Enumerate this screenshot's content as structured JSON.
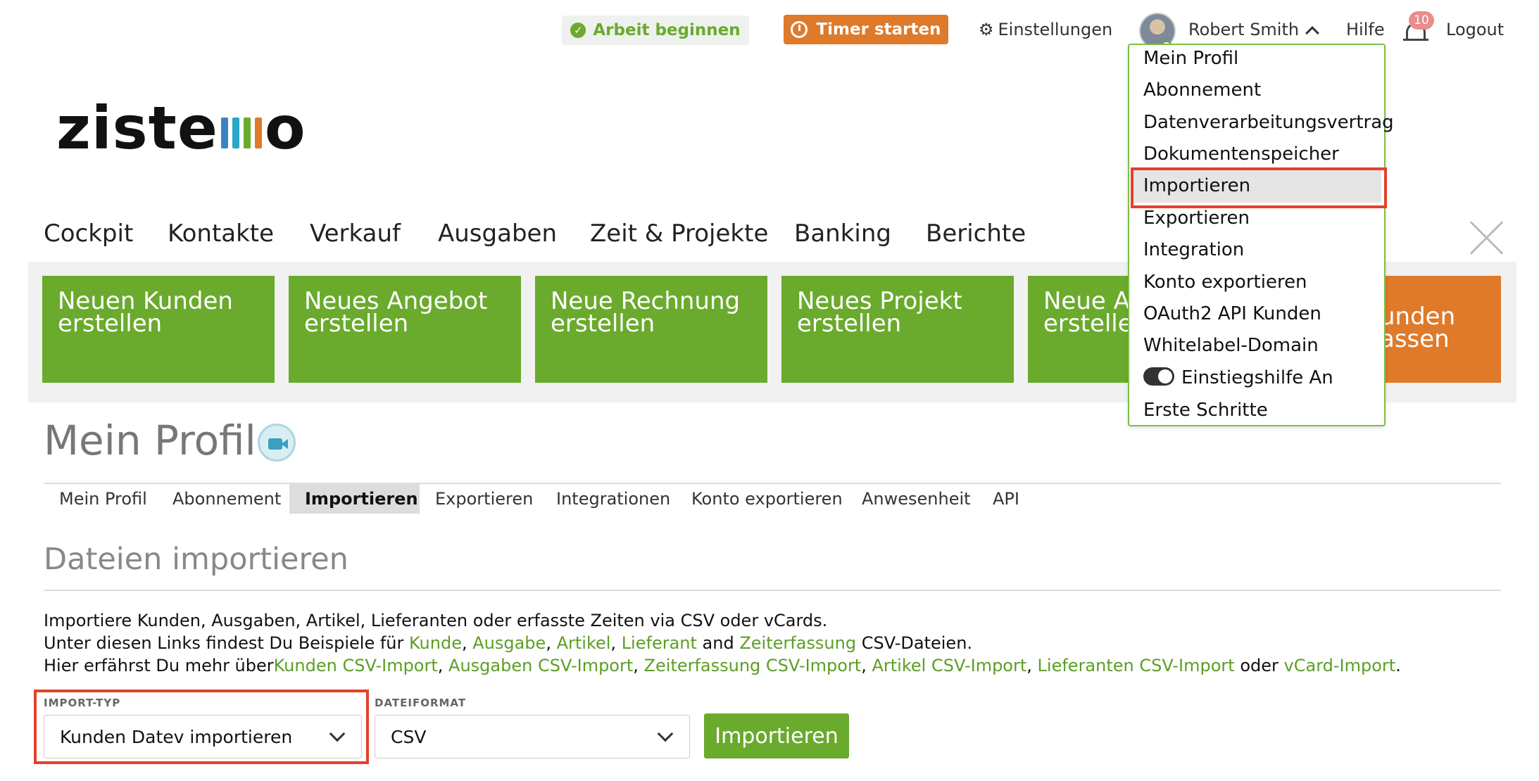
{
  "header": {
    "work_label": "Arbeit beginnen",
    "timer_label": "Timer starten",
    "settings_label": "Einstellungen",
    "user_name": "Robert Smith",
    "help_label": "Hilfe",
    "notification_count": "10",
    "logout_label": "Logout"
  },
  "logo": {
    "text_left": "zist",
    "text_e": "e",
    "text_right": "o",
    "bar_colors": [
      "#3b82c4",
      "#2aa6c8",
      "#6aaa2d",
      "#de7a2a"
    ]
  },
  "main_nav": [
    "Cockpit",
    "Kontakte",
    "Verkauf",
    "Ausgaben",
    "Zeit & Projekte",
    "Banking",
    "Berichte"
  ],
  "tiles": [
    {
      "line1": "Neuen Kunden",
      "line2": "erstellen"
    },
    {
      "line1": "Neues Angebot",
      "line2": "erstellen"
    },
    {
      "line1": "Neue Rechnung",
      "line2": "erstellen"
    },
    {
      "line1": "Neues Projekt",
      "line2": "erstellen"
    },
    {
      "line1": "Neue Au",
      "line2": "ersteller"
    },
    {
      "line1": "unden",
      "line2": "assen"
    }
  ],
  "page": {
    "title": "Mein Profil",
    "tabs": [
      "Mein Profil",
      "Abonnement",
      "Importieren",
      "Exportieren",
      "Integrationen",
      "Konto exportieren",
      "Anwesenheit",
      "API"
    ],
    "active_tab": "Importieren",
    "section_title": "Dateien importieren",
    "intro_line1": "Importiere Kunden, Ausgaben, Artikel, Lieferanten oder erfasste Zeiten via CSV oder vCards.",
    "intro_line2_prefix": "Unter diesen Links findest Du Beispiele für",
    "example_links": [
      "Kunde",
      "Ausgabe",
      "Artikel",
      "Lieferant",
      "Zeiterfassung"
    ],
    "intro_line2_and": "and",
    "intro_line2_suffix": "CSV-Dateien.",
    "intro_line3_prefix": "Hier erfährst Du mehr über",
    "info_links": [
      "Kunden CSV-Import",
      "Ausgaben CSV-Import",
      "Zeiterfassung CSV-Import",
      "Artikel CSV-Import",
      "Lieferanten CSV-Import",
      "vCard-Import"
    ],
    "intro_line3_or": "oder",
    "import_type_label": "IMPORT-TYP",
    "import_type_value": "Kunden Datev importieren",
    "file_format_label": "DATEIFORMAT",
    "file_format_value": "CSV",
    "import_button": "Importieren"
  },
  "user_menu": {
    "items": [
      "Mein Profil",
      "Abonnement",
      "Datenverarbeitungsvertrag",
      "Dokumentenspeicher",
      "Importieren",
      "Exportieren",
      "Integration",
      "Konto exportieren",
      "OAuth2 API Kunden",
      "Whitelabel-Domain",
      "Einstiegshilfe An",
      "Erste Schritte"
    ],
    "highlighted": "Importieren",
    "toggle_on": true
  },
  "colors": {
    "brand_green": "#6aaa2d",
    "accent_orange": "#de7a2a",
    "highlight_red": "#e4402b"
  }
}
